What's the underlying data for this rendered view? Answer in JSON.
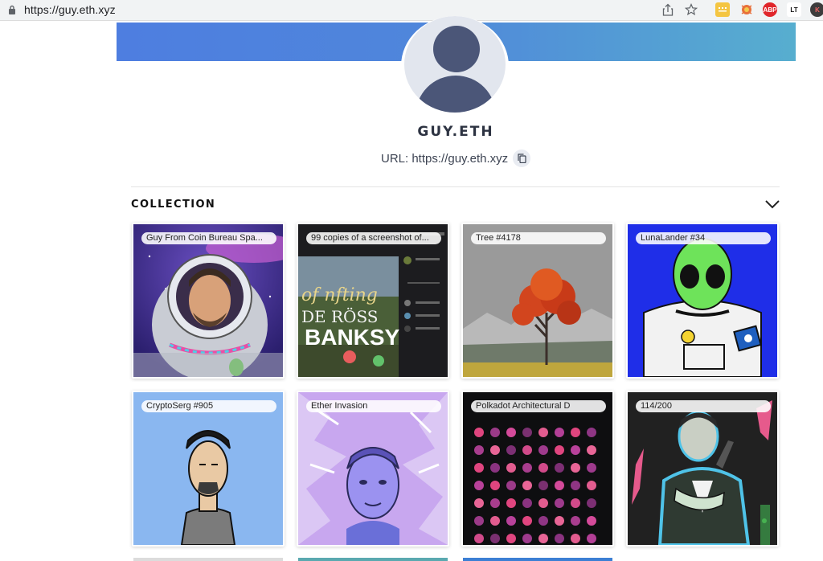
{
  "browser": {
    "url": "https://guy.eth.xyz",
    "extensions": [
      {
        "icon": "notes-extension-icon",
        "color": "#f4c542",
        "text": ""
      },
      {
        "icon": "honey-extension-icon",
        "color": "#e8703a",
        "text": ""
      },
      {
        "icon": "adblock-plus-icon",
        "color": "#e0262b",
        "text": "ABP"
      },
      {
        "icon": "languagetool-icon",
        "color": "#ffffff",
        "text": "LT"
      },
      {
        "icon": "profile-avatar-icon",
        "color": "#3c3c3c",
        "text": "K"
      }
    ]
  },
  "profile": {
    "name": "GUY.ETH",
    "url_label": "URL: https://guy.eth.xyz"
  },
  "collection": {
    "title": "COLLECTION",
    "items": [
      {
        "label": "Guy From Coin Bureau Spa..."
      },
      {
        "label": "99 copies of a screenshot of..."
      },
      {
        "label": "Tree #4178"
      },
      {
        "label": "LunaLander #34"
      },
      {
        "label": "CryptoSerg #905"
      },
      {
        "label": "Ether Invasion"
      },
      {
        "label": "Polkadot Architectural D"
      },
      {
        "label": "114/200"
      }
    ]
  },
  "colors": {
    "banner_start": "#4e7ee0",
    "banner_end": "#57aecf",
    "avatar_fill": "#4b5678"
  }
}
